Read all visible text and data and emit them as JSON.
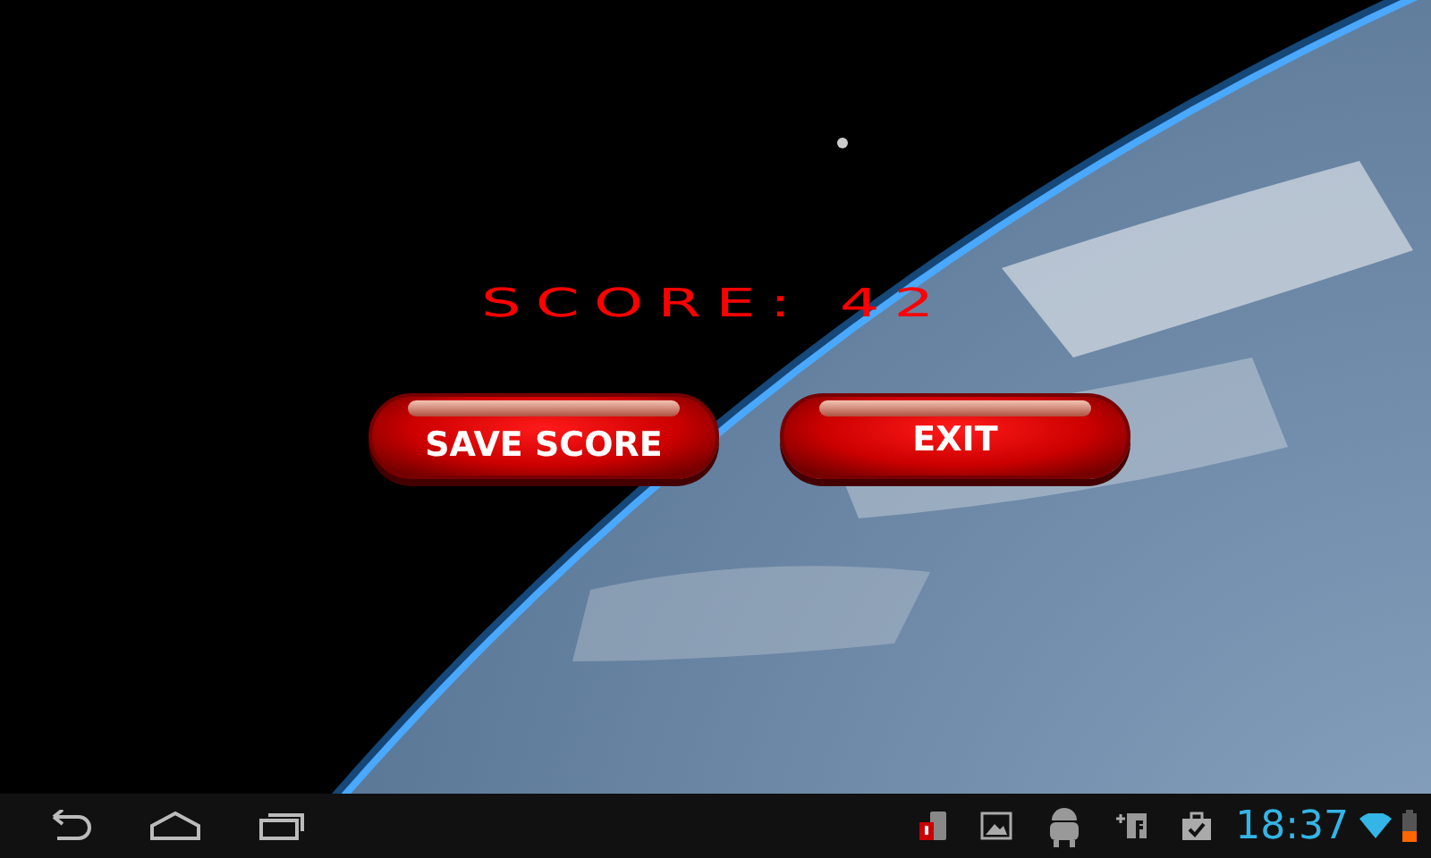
{
  "score": {
    "text": "SCORE: 42"
  },
  "buttons": [
    {
      "label": "SAVE SCORE"
    },
    {
      "label": "EXIT"
    }
  ],
  "status_bar": {
    "time": "18:37"
  }
}
